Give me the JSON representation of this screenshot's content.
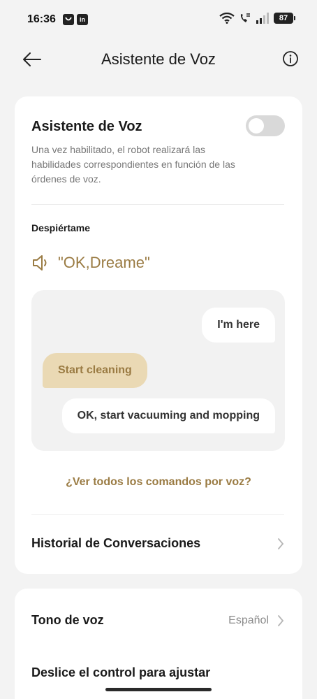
{
  "status_bar": {
    "time": "16:36",
    "app_icon_2": "in",
    "battery": "87"
  },
  "header": {
    "title": "Asistente de Voz"
  },
  "voice_assistant": {
    "title": "Asistente de Voz",
    "enabled": false,
    "description": "Una vez habilitado, el robot realizará las habilidades correspondientes en función de las órdenes de voz."
  },
  "wake": {
    "label": "Despiértame",
    "phrase": "\"OK,Dreame\""
  },
  "chat": {
    "reply_1": "I'm here",
    "user_command": "Start cleaning",
    "reply_2": "OK, start vacuuming and mopping"
  },
  "commands_link": "¿Ver todos los comandos por voz?",
  "history": {
    "label": "Historial de Conversaciones"
  },
  "tone": {
    "label": "Tono de voz",
    "value": "Español"
  },
  "slide_control": {
    "label": "Deslice el control para ajustar"
  },
  "colors": {
    "accent": "#9a7b43",
    "user_bubble": "#ead9b4",
    "background": "#f3f3f3"
  }
}
